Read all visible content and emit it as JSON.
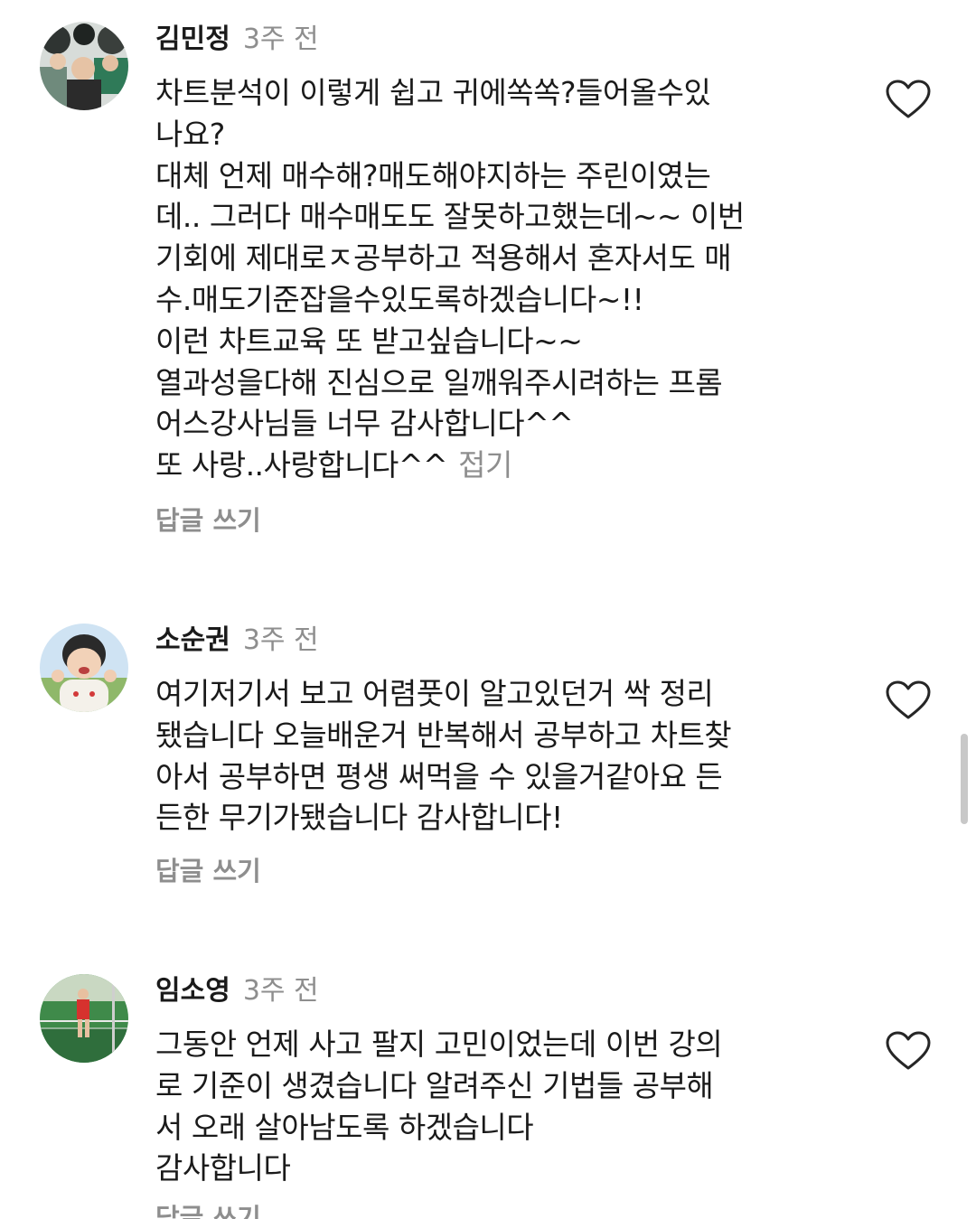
{
  "comments": [
    {
      "author": "김민정",
      "time": "3주 전",
      "lines": [
        "차트분석이 이렇게 쉽고 귀에쏙쏙?들어올수있",
        "나요?",
        "대체 언제 매수해?매도해야지하는 주린이였는",
        "데.. 그러다 매수매도도 잘못하고했는데~~ 이번",
        "기회에 제대로ㅈ공부하고 적용해서 혼자서도 매",
        "수.매도기준잡을수있도록하겠습니다~!!",
        "이런 차트교육 또 받고싶습니다~~",
        "열과성을다해 진심으로 일깨워주시려하는 프롬",
        "어스강사님들 너무 감사합니다^^",
        "또 사랑..사랑합니다^^"
      ],
      "collapse_label": "접기",
      "reply_label": "답글 쓰기"
    },
    {
      "author": "소순권",
      "time": "3주 전",
      "lines": [
        "여기저기서 보고 어렴풋이 알고있던거 싹 정리",
        "됐습니다 오늘배운거 반복해서 공부하고 차트찾",
        "아서 공부하면 평생 써먹을 수 있을거같아요 든",
        "든한 무기가됐습니다 감사합니다!"
      ],
      "reply_label": "답글 쓰기"
    },
    {
      "author": "임소영",
      "time": "3주 전",
      "lines": [
        "그동안 언제 사고 팔지 고민이었는데 이번 강의",
        "로 기준이 생겼습니다 알려주신 기법들 공부해",
        "서 오래 살아남도록 하겠습니다",
        "감사합니다"
      ],
      "reply_label": "답글 쓰기"
    }
  ],
  "icons": {
    "like": "heart-outline-icon"
  },
  "colors": {
    "text": "#1a1a1a",
    "muted": "#8e8e8e",
    "background": "#ffffff"
  }
}
